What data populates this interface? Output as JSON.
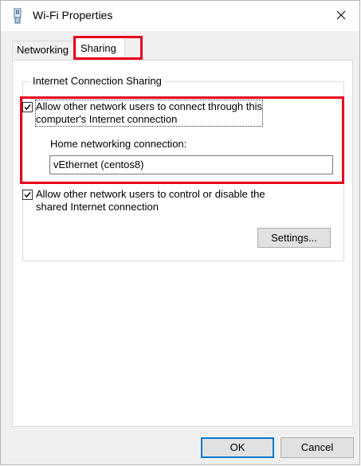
{
  "window": {
    "title": "Wi-Fi Properties",
    "icon": "wifi-adapter-icon",
    "close_icon": "close-icon"
  },
  "tabs": [
    {
      "label": "Networking",
      "selected": false
    },
    {
      "label": "Sharing",
      "selected": true
    }
  ],
  "sharing": {
    "group_title": "Internet Connection Sharing",
    "allow_connect": {
      "checked": true,
      "label_line1": "Allow other network users to connect through this",
      "label_line2": "computer's Internet connection"
    },
    "home_networking_label": "Home networking connection:",
    "home_networking_value": "vEthernet (centos8)",
    "allow_control": {
      "checked": true,
      "label_line1": "Allow other network users to control or disable the",
      "label_line2": "shared Internet connection"
    },
    "settings_button": "Settings..."
  },
  "footer": {
    "ok_button": "OK",
    "cancel_button": "Cancel"
  },
  "colors": {
    "highlight": "#e8001c",
    "focus_border": "#0078d7"
  }
}
